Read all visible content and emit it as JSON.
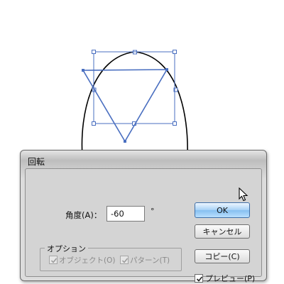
{
  "dialog": {
    "title": "回転",
    "angle_label": "角度(A)：",
    "angle_value": "-60",
    "degree_symbol": "°",
    "options_group": {
      "title": "オプション",
      "object_label": "オブジェクト(O)",
      "pattern_label": "パターン(T)",
      "object_checked": true,
      "pattern_checked": true,
      "disabled": true
    },
    "ok_label": "OK",
    "cancel_label": "キャンセル",
    "copy_label": "コピー(C)",
    "preview_label": "プレビュー(P)",
    "preview_checked": true
  },
  "colors": {
    "selection_blue": "#4a6fc0",
    "ok_button": "#9fcdf3"
  },
  "canvas": {
    "shapes": [
      "ellipse-outline",
      "triangle-rotated",
      "bounding-box"
    ]
  }
}
